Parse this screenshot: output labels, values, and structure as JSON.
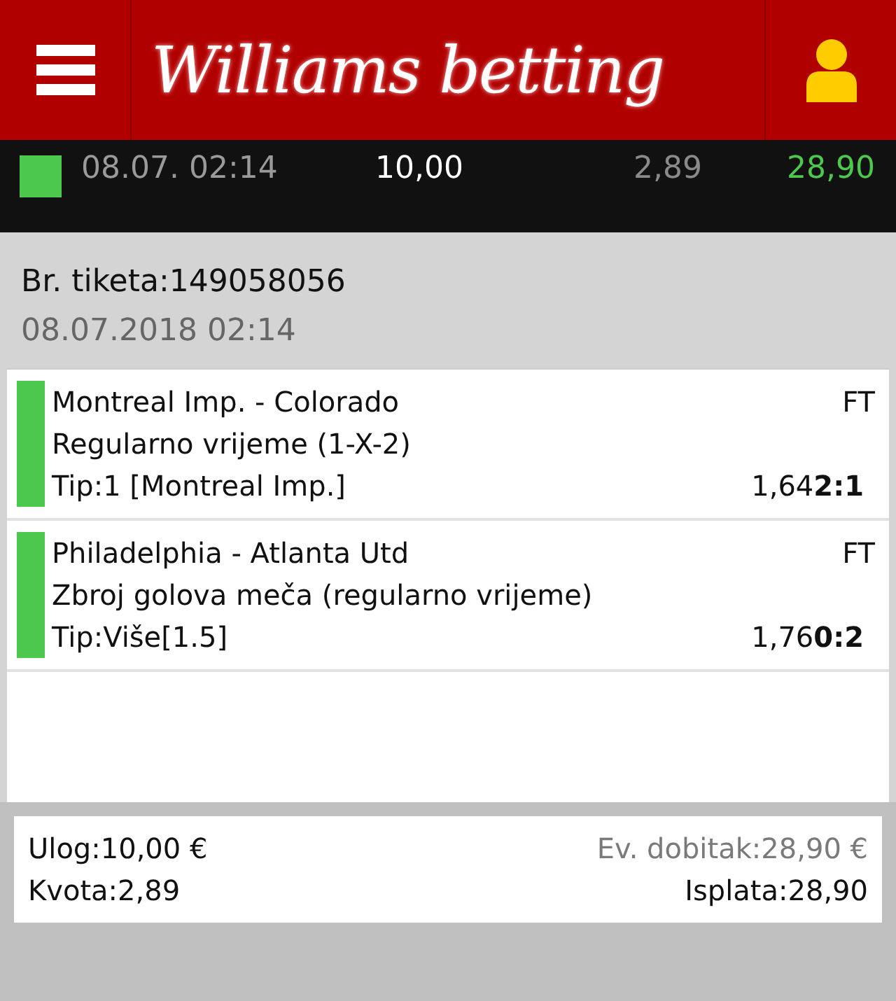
{
  "header": {
    "logo": "Williams betting"
  },
  "summary_row": {
    "color": "#4cc94c",
    "date": "08.07. 02:14",
    "stake": "10,00",
    "odds": "2,89",
    "payout": "28,90"
  },
  "ticket": {
    "number_label": "Br. tiketa:149058056",
    "date": "08.07.2018 02:14"
  },
  "bets": [
    {
      "color": "#4cc94c",
      "match": "Montreal Imp. - Colorado",
      "status": "FT",
      "market": "Regularno vrijeme (1-X-2)",
      "tip": "Tip:1 [Montreal Imp.]",
      "odds": "1,64",
      "score": "2:1"
    },
    {
      "color": "#4cc94c",
      "match": "Philadelphia - Atlanta Utd",
      "status": "FT",
      "market": "Zbroj golova meča (regularno vrijeme)",
      "tip": "Tip:Više[1.5]",
      "odds": "1,76",
      "score": "0:2"
    }
  ],
  "totals": {
    "stake": "Ulog:10,00 €",
    "potential_win": "Ev. dobitak:28,90 €",
    "odds": "Kvota:2,89",
    "payout": "Isplata:28,90"
  }
}
